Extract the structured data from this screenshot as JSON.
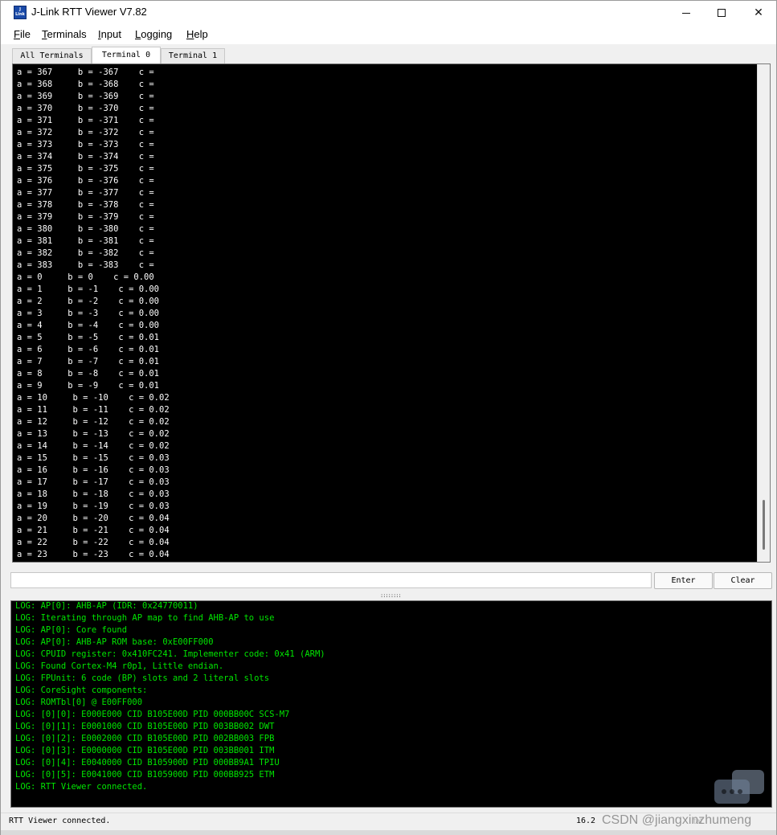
{
  "window": {
    "icon_text": "J",
    "icon_sub": "Link",
    "title": "J-Link RTT Viewer V7.82",
    "min_label": "",
    "close_label": "✕"
  },
  "menu": [
    "File",
    "Terminals",
    "Input",
    "Logging",
    "Help"
  ],
  "tabs": [
    "All Terminals",
    "Terminal 0",
    "Terminal 1"
  ],
  "active_tab": "Terminal 0",
  "terminal_lines": [
    "a = 367     b = -367    c =",
    "a = 368     b = -368    c =",
    "a = 369     b = -369    c =",
    "a = 370     b = -370    c =",
    "a = 371     b = -371    c =",
    "a = 372     b = -372    c =",
    "a = 373     b = -373    c =",
    "a = 374     b = -374    c =",
    "a = 375     b = -375    c =",
    "a = 376     b = -376    c =",
    "a = 377     b = -377    c =",
    "a = 378     b = -378    c =",
    "a = 379     b = -379    c =",
    "a = 380     b = -380    c =",
    "a = 381     b = -381    c =",
    "a = 382     b = -382    c =",
    "a = 383     b = -383    c =",
    "a = 0     b = 0    c = 0.00",
    "a = 1     b = -1    c = 0.00",
    "a = 2     b = -2    c = 0.00",
    "a = 3     b = -3    c = 0.00",
    "a = 4     b = -4    c = 0.00",
    "a = 5     b = -5    c = 0.01",
    "a = 6     b = -6    c = 0.01",
    "a = 7     b = -7    c = 0.01",
    "a = 8     b = -8    c = 0.01",
    "a = 9     b = -9    c = 0.01",
    "a = 10     b = -10    c = 0.02",
    "a = 11     b = -11    c = 0.02",
    "a = 12     b = -12    c = 0.02",
    "a = 13     b = -13    c = 0.02",
    "a = 14     b = -14    c = 0.02",
    "a = 15     b = -15    c = 0.03",
    "a = 16     b = -16    c = 0.03",
    "a = 17     b = -17    c = 0.03",
    "a = 18     b = -18    c = 0.03",
    "a = 19     b = -19    c = 0.03",
    "a = 20     b = -20    c = 0.04",
    "a = 21     b = -21    c = 0.04",
    "a = 22     b = -22    c = 0.04",
    "a = 23     b = -23    c = 0.04"
  ],
  "input": {
    "value": "",
    "enter_label": "Enter",
    "clear_label": "Clear"
  },
  "splitter_label": "::::::::",
  "log_lines": [
    "LOG: AP[0]: AHB-AP (IDR: 0x24770011)",
    "LOG: Iterating through AP map to find AHB-AP to use",
    "LOG: AP[0]: Core found",
    "LOG: AP[0]: AHB-AP ROM base: 0xE00FF000",
    "LOG: CPUID register: 0x410FC241. Implementer code: 0x41 (ARM)",
    "LOG: Found Cortex-M4 r0p1, Little endian.",
    "LOG: FPUnit: 6 code (BP) slots and 2 literal slots",
    "LOG: CoreSight components:",
    "LOG: ROMTbl[0] @ E00FF000",
    "LOG: [0][0]: E000E000 CID B105E00D PID 000BB00C SCS-M7",
    "LOG: [0][1]: E0001000 CID B105E00D PID 003BB002 DWT",
    "LOG: [0][2]: E0002000 CID B105E00D PID 002BB003 FPB",
    "LOG: [0][3]: E0000000 CID B105E00D PID 003BB001 ITM",
    "LOG: [0][4]: E0040000 CID B105900D PID 000BB9A1 TPIU",
    "LOG: [0][5]: E0041000 CID B105900D PID 000BB925 ETM",
    "LOG: RTT Viewer connected."
  ],
  "status": {
    "message": "RTT Viewer connected.",
    "data_size": "16.2",
    "watermark": "CSDN @jiangxinzhumeng",
    "right_text": "tat"
  },
  "colors": {
    "terminal_bg": "#000000",
    "terminal_fg": "#ffffff",
    "log_fg": "#00e500"
  },
  "icons": {
    "app": "jlink-logo-icon",
    "minimize": "minimize-icon",
    "maximize": "maximize-icon",
    "close": "close-icon",
    "watermark_chat": "chat-bubble-icon"
  }
}
